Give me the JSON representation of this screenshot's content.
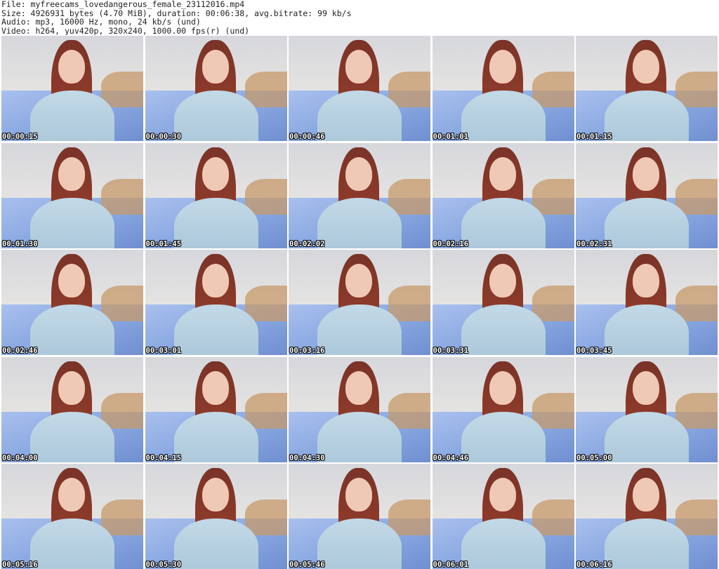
{
  "header": {
    "file_line": "File: myfreecams_lovedangerous_female_23112016.mp4",
    "size_line": "Size: 4926931 bytes (4.70 MiB), duration: 00:06:38, avg.bitrate: 99 kb/s",
    "audio_line": "Audio: mp3, 16000 Hz, mono, 24 kb/s (und)",
    "video_line": "Video: h264, yuv420p, 320x240, 1000.00 fps(r) (und)"
  },
  "thumbnails": [
    {
      "timestamp": "00:00:15"
    },
    {
      "timestamp": "00:00:30"
    },
    {
      "timestamp": "00:00:46"
    },
    {
      "timestamp": "00:01:01"
    },
    {
      "timestamp": "00:01:15"
    },
    {
      "timestamp": "00:01:30"
    },
    {
      "timestamp": "00:01:45"
    },
    {
      "timestamp": "00:02:02"
    },
    {
      "timestamp": "00:02:16"
    },
    {
      "timestamp": "00:02:31"
    },
    {
      "timestamp": "00:02:46"
    },
    {
      "timestamp": "00:03:01"
    },
    {
      "timestamp": "00:03:16"
    },
    {
      "timestamp": "00:03:31"
    },
    {
      "timestamp": "00:03:45"
    },
    {
      "timestamp": "00:04:00"
    },
    {
      "timestamp": "00:04:15"
    },
    {
      "timestamp": "00:04:30"
    },
    {
      "timestamp": "00:04:46"
    },
    {
      "timestamp": "00:05:00"
    },
    {
      "timestamp": "00:05:16"
    },
    {
      "timestamp": "00:05:30"
    },
    {
      "timestamp": "00:05:46"
    },
    {
      "timestamp": "00:06:01"
    },
    {
      "timestamp": "00:06:16"
    }
  ]
}
